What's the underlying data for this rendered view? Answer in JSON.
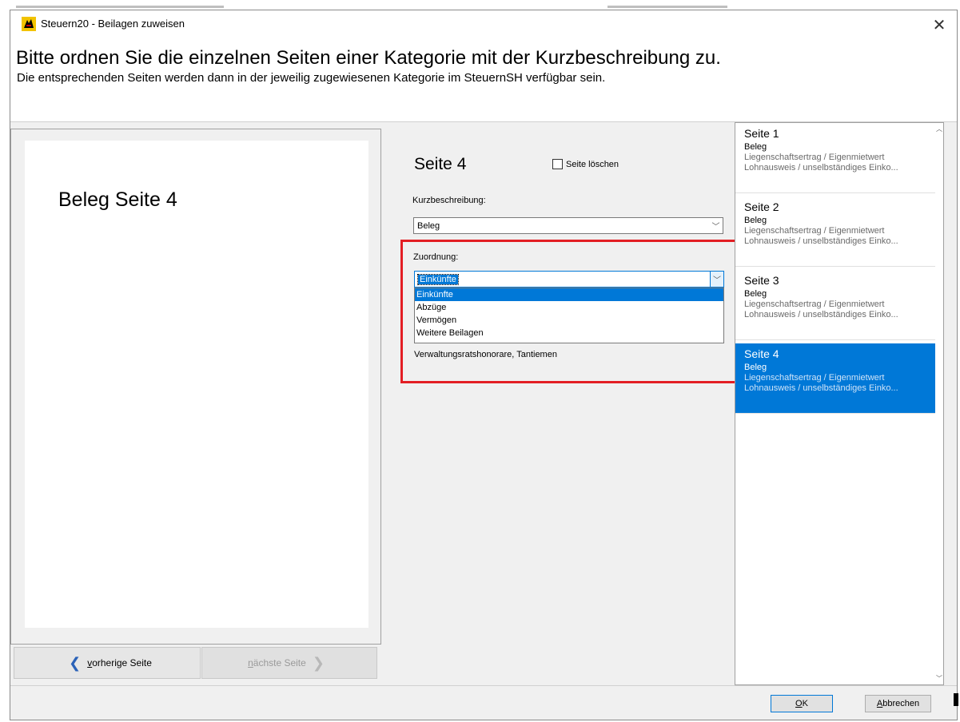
{
  "window": {
    "title": "Steuern20 - Beilagen zuweisen",
    "close_glyph": "✕"
  },
  "header": {
    "title": "Bitte ordnen Sie die einzelnen Seiten einer Kategorie mit der Kurzbeschreibung zu.",
    "subtitle": "Die entsprechenden Seiten werden dann in der jeweilig zugewiesenen Kategorie im SteuernSH verfügbar sein."
  },
  "preview": {
    "text": "Beleg Seite 4"
  },
  "navigation": {
    "prev_prefix": "v",
    "prev_rest": "orherige Seite",
    "next_prefix": "n",
    "next_rest": "ächste Seite"
  },
  "details": {
    "page_heading": "Seite 4",
    "delete_label": "Seite löschen",
    "delete_checked": false,
    "kurz_label": "Kurzbeschreibung:",
    "kurz_value": "Beleg",
    "zuordnung_label": "Zuordnung:",
    "zuordnung_value": "Einkünfte",
    "options": [
      "Einkünfte",
      "Abzüge",
      "Vermögen",
      "Weitere Beilagen"
    ],
    "behind_text": "Verwaltungsratshonorare, Tantiemen"
  },
  "pages": [
    {
      "title": "Seite 1",
      "line1": "Beleg",
      "line2": "Liegenschaftsertrag / Eigenmietwert",
      "line3": "Lohnausweis / unselbständiges Einko..."
    },
    {
      "title": "Seite 2",
      "line1": "Beleg",
      "line2": "Liegenschaftsertrag / Eigenmietwert",
      "line3": "Lohnausweis / unselbständiges Einko..."
    },
    {
      "title": "Seite 3",
      "line1": "Beleg",
      "line2": "Liegenschaftsertrag / Eigenmietwert",
      "line3": "Lohnausweis / unselbständiges Einko..."
    },
    {
      "title": "Seite 4",
      "line1": "Beleg",
      "line2": "Liegenschaftsertrag / Eigenmietwert",
      "line3": "Lohnausweis / unselbständiges Einko..."
    }
  ],
  "selected_page_index": 3,
  "buttons": {
    "ok_prefix": "O",
    "ok_rest": "K",
    "cancel_prefix": "A",
    "cancel_rest": "bbrechen"
  },
  "colors": {
    "accent": "#0078d7",
    "highlight_box": "#e31e24"
  }
}
